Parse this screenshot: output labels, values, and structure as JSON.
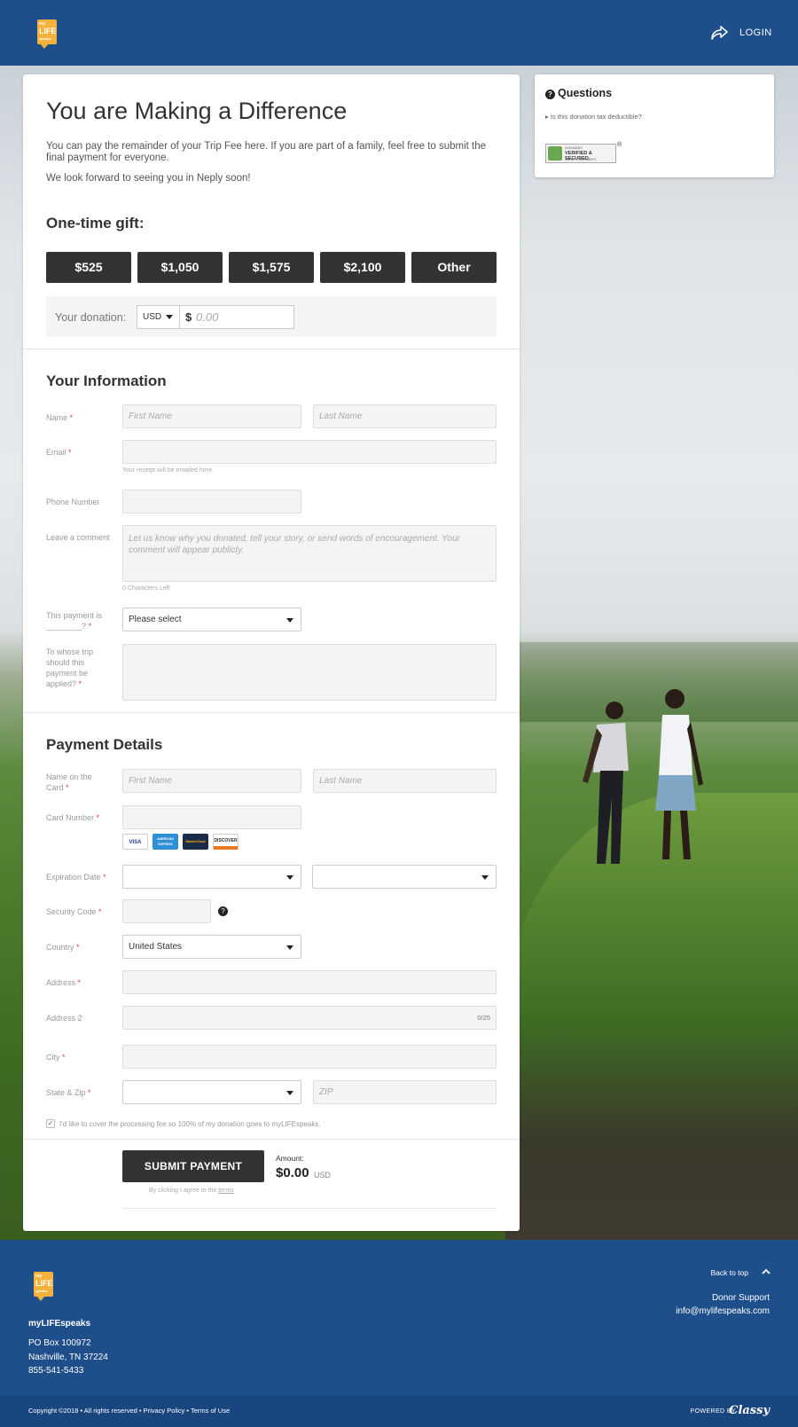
{
  "header": {
    "logo_lines": [
      "my",
      "LIFE",
      "speaks"
    ],
    "login": "LOGIN"
  },
  "main": {
    "title": "You are Making a Difference",
    "intro_1": "You can pay the remainder of your Trip Fee here. If you are part of a family, feel free to submit the final payment for everyone.",
    "intro_2": "We look forward to seeing you in Neply soon!",
    "gift_heading": "One-time gift:",
    "amounts": [
      "$525",
      "$1,050",
      "$1,575",
      "$2,100",
      "Other"
    ],
    "donation_label": "Your donation:",
    "currency": "USD",
    "currency_symbol": "$",
    "donation_placeholder": "0.00"
  },
  "info": {
    "heading": "Your Information",
    "name_label": "Name",
    "first_placeholder": "First Name",
    "last_placeholder": "Last Name",
    "email_label": "Email",
    "email_hint": "Your receipt will be emailed here.",
    "phone_label": "Phone Number",
    "comment_label": "Leave a comment",
    "comment_placeholder": "Let us know why you donated, tell your story, or send words of encouragement. Your comment will appear publicly.",
    "comment_hint": "0 Characters Left",
    "payment_is_label": "This payment is ________?",
    "payment_is_value": "Please select",
    "trip_label": "To whose trip should this payment be applied?",
    "required": "*"
  },
  "payment": {
    "heading": "Payment Details",
    "card_name_label": "Name on the Card",
    "first_placeholder": "First Name",
    "last_placeholder": "Last Name",
    "card_number_label": "Card Number",
    "cards": [
      "VISA",
      "AMERICAN EXPRESS",
      "MasterCard",
      "DISCOVER"
    ],
    "expiration_label": "Expiration Date",
    "security_label": "Security Code",
    "country_label": "Country",
    "country_value": "United States",
    "address_label": "Address",
    "address2_label": "Address 2",
    "address2_counter": "0/25",
    "city_label": "City",
    "state_zip_label": "State & Zip",
    "zip_placeholder": "ZIP",
    "fee_text": "I'd like to cover the processing fee so 100% of my donation goes to myLIFEspeaks.",
    "submit": "SUBMIT PAYMENT",
    "amount_label": "Amount:",
    "amount_value": "$0.00",
    "amount_currency": "USD",
    "terms_prefix": "By clicking I agree to the ",
    "terms_link": "terms"
  },
  "questions": {
    "title": "Questions",
    "link": "Is this donation tax deductible?",
    "seal_lines": [
      "GODADDY",
      "VERIFIED & SECURED",
      "VERIFY SECURITY"
    ]
  },
  "footer": {
    "org": "myLIFEspeaks",
    "address": [
      "PO Box 100972",
      "Nashville, TN 37224",
      "855-541-5433"
    ],
    "back_to_top": "Back to top",
    "support_label": "Donor Support",
    "support_email": "info@mylifespeaks.com",
    "copyright": "Copyright ©2018 • All rights reserved • ",
    "privacy": "Privacy Policy",
    "sep": " • ",
    "terms": "Terms of Use",
    "powered_by": "POWERED BY",
    "powered_brand": "Classy"
  },
  "colors": {
    "brand_blue": "#1f4f8b",
    "button_dark": "#333333",
    "logo_yellow": "#f4b13b",
    "required_red": "#e0444c"
  }
}
